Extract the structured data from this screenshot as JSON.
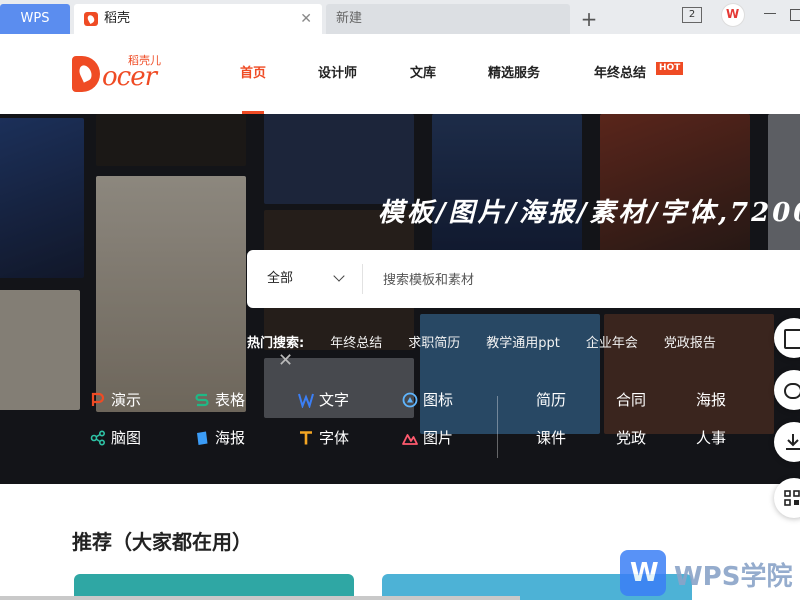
{
  "tabs": {
    "wps_label": "WPS",
    "active_label": "稻壳",
    "new_label": "新建",
    "window_count": "2"
  },
  "logo": {
    "sub": "稻壳儿",
    "word": "ocer"
  },
  "nav": {
    "items": [
      "首页",
      "设计师",
      "文库",
      "精选服务",
      "年终总结"
    ],
    "hot_badge": "HOT"
  },
  "hero": {
    "title": "模板/图片/海报/素材/字体,7200",
    "search": {
      "category": "全部",
      "placeholder": "搜索模板和素材"
    },
    "hot_search": {
      "label": "热门搜索:",
      "terms": [
        "年终总结",
        "求职简历",
        "教学通用ppt",
        "企业年会",
        "党政报告"
      ]
    },
    "categories": [
      {
        "label": "演示",
        "icon": "ppt-icon",
        "color": "#ef4b24"
      },
      {
        "label": "表格",
        "icon": "sheet-icon",
        "color": "#1fb885"
      },
      {
        "label": "文字",
        "icon": "word-icon",
        "color": "#3b7ff6"
      },
      {
        "label": "图标",
        "icon": "icon-icon",
        "color": "#5fb6ff"
      },
      {
        "label": "脑图",
        "icon": "mindmap-icon",
        "color": "#2ec4a6"
      },
      {
        "label": "海报",
        "icon": "poster-icon",
        "color": "#3b9cf6"
      },
      {
        "label": "字体",
        "icon": "font-icon",
        "color": "#f5a623"
      },
      {
        "label": "图片",
        "icon": "image-icon",
        "color": "#ff5a6e"
      }
    ],
    "text_categories": [
      "简历",
      "合同",
      "海报",
      "课件",
      "党政",
      "人事"
    ]
  },
  "recommend": {
    "title": "推荐（大家都在用）"
  },
  "watermark": {
    "text": "WPS学院"
  },
  "colors": {
    "accent": "#ef4b24",
    "tab_wps": "#5b8def"
  }
}
